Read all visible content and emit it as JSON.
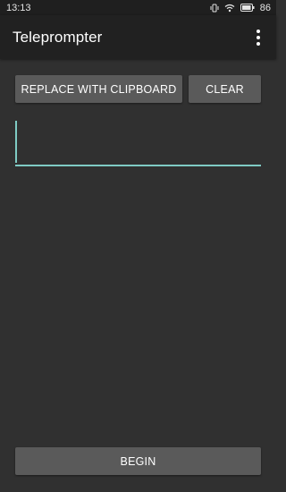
{
  "status_bar": {
    "time": "13:13",
    "battery_level": "86",
    "icons": [
      "vibrate-icon",
      "wifi-icon",
      "battery-icon"
    ]
  },
  "app_bar": {
    "title": "Teleprompter",
    "menu_icon": "overflow-menu-icon"
  },
  "toolbar": {
    "replace_label": "REPLACE WITH CLIPBOARD",
    "clear_label": "CLEAR"
  },
  "editor": {
    "value": "",
    "placeholder": ""
  },
  "footer": {
    "begin_label": "BEGIN"
  },
  "colors": {
    "background": "#303030",
    "app_bar": "#212121",
    "button": "#5a5a5a",
    "accent": "#7fcbc4"
  }
}
